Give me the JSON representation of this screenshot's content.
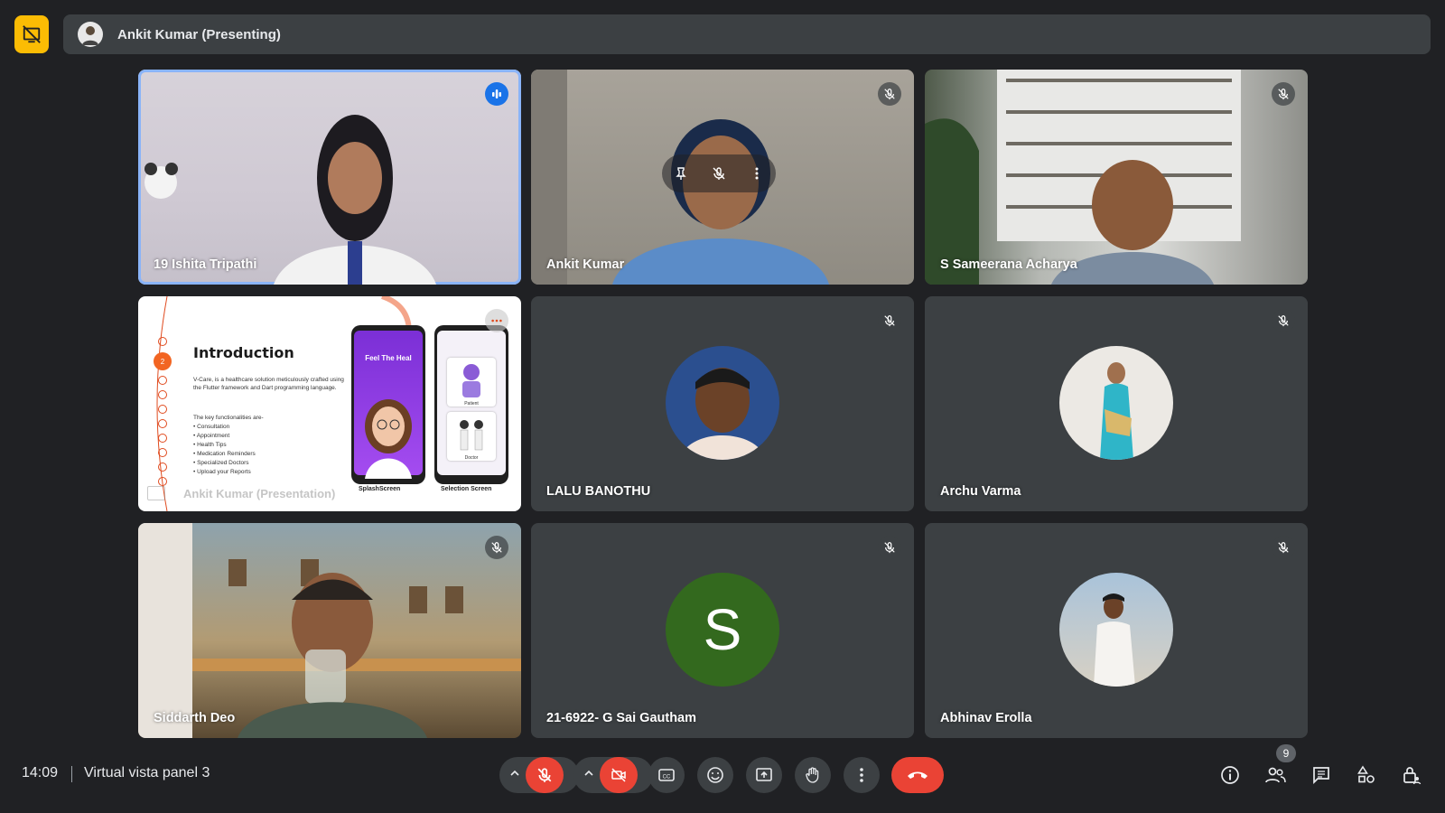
{
  "header": {
    "presenting_title": "Ankit Kumar (Presenting)"
  },
  "tiles": [
    {
      "name": "19 Ishita Tripathi",
      "status": "speaking"
    },
    {
      "name": "Ankit Kumar",
      "status": "muted"
    },
    {
      "name": "S Sameerana Acharya",
      "status": "muted"
    },
    {
      "name": "Ankit Kumar (Presentation)",
      "status": "presentation"
    },
    {
      "name": "LALU BANOTHU",
      "status": "muted"
    },
    {
      "name": "Archu Varma",
      "status": "muted"
    },
    {
      "name": "Siddarth Deo",
      "status": "muted"
    },
    {
      "name": "21-6922- G Sai Gautham",
      "status": "muted",
      "initial": "S"
    },
    {
      "name": "Abhinav Erolla",
      "status": "muted"
    }
  ],
  "slide": {
    "title": "Introduction",
    "body": "V-Care, is a healthcare solution meticulously crafted using the Flutter framework and Dart programming language.",
    "list_intro": "The key functionalities are-",
    "items": [
      "Consultation",
      "Appointment",
      "Health Tips",
      "Medication Reminders",
      "Specialized Doctors",
      "Upload your Reports"
    ],
    "phone1_headline": "Feel The Heal",
    "phone1_caption": "SplashScreen",
    "phone2_caption": "Selection Screen",
    "phone2_role1": "Patient",
    "phone2_role2": "Doctor",
    "active_step": "2"
  },
  "footer": {
    "time": "14:09",
    "meeting_name": "Virtual vista panel 3",
    "participants_count": "9"
  },
  "colors": {
    "background": "#202124",
    "tile": "#3c4043",
    "accent_blue": "#1a73e8",
    "danger_red": "#ea4335",
    "presenting_icon": "#fbbc04",
    "letter_avatar": "#33691e"
  }
}
